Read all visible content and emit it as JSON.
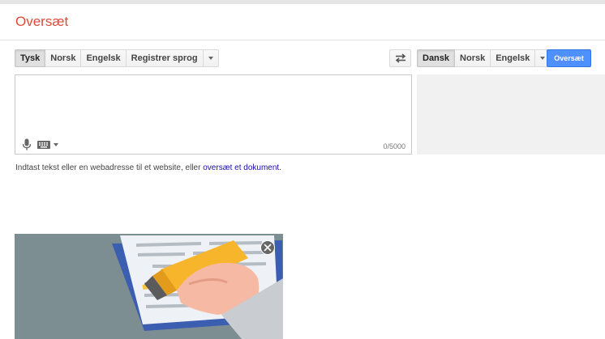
{
  "header": {
    "title": "Oversæt"
  },
  "source_langs": {
    "items": [
      {
        "label": "Tysk",
        "active": true
      },
      {
        "label": "Norsk",
        "active": false
      },
      {
        "label": "Engelsk",
        "active": false
      },
      {
        "label": "Registrer sprog",
        "active": false
      }
    ]
  },
  "target_langs": {
    "items": [
      {
        "label": "Dansk",
        "active": true
      },
      {
        "label": "Norsk",
        "active": false
      },
      {
        "label": "Engelsk",
        "active": false
      }
    ]
  },
  "translate_button": {
    "label": "Oversæt"
  },
  "source": {
    "value": "",
    "char_count": "0/5000"
  },
  "hint": {
    "text": "Indtast tekst eller en webadresse til et website, eller ",
    "link": "oversæt et dokument",
    "suffix": "."
  },
  "icons": {
    "swap": "swap-languages-icon",
    "mic": "microphone-icon",
    "keyboard": "keyboard-icon",
    "close": "close-icon"
  },
  "colors": {
    "accent": "#4d90fe",
    "title": "#dd4b39"
  }
}
